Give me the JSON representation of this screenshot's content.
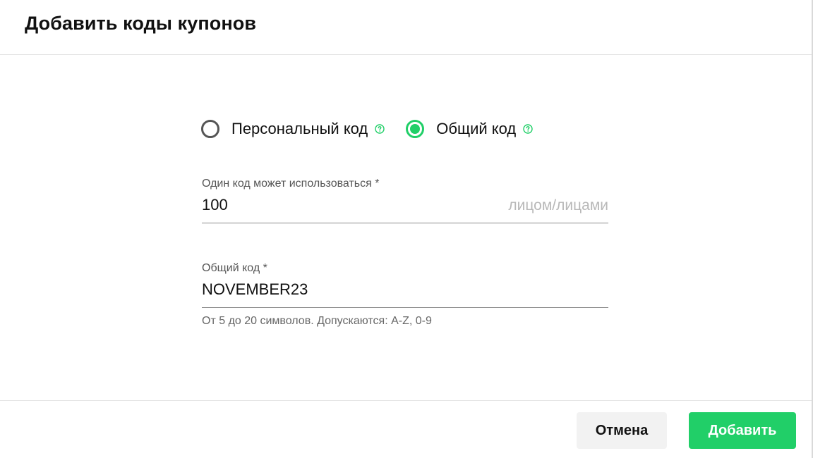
{
  "dialog": {
    "title": "Добавить коды купонов"
  },
  "code_type": {
    "options": [
      {
        "label": "Персональный код",
        "selected": false,
        "help_icon": "question-circle-icon"
      },
      {
        "label": "Общий код",
        "selected": true,
        "help_icon": "question-circle-icon"
      }
    ]
  },
  "usage_field": {
    "label": "Один код может использоваться *",
    "value": "100",
    "suffix": "лицом/лицами"
  },
  "code_field": {
    "label": "Общий код *",
    "value": "NOVEMBER23",
    "hint": "От 5 до 20 символов. Допускаются: A-Z, 0-9"
  },
  "footer": {
    "cancel_label": "Отмена",
    "add_label": "Добавить"
  },
  "colors": {
    "accent": "#21cf68",
    "radio_unselected": "#555555",
    "cancel_bg": "#f2f2f2"
  }
}
